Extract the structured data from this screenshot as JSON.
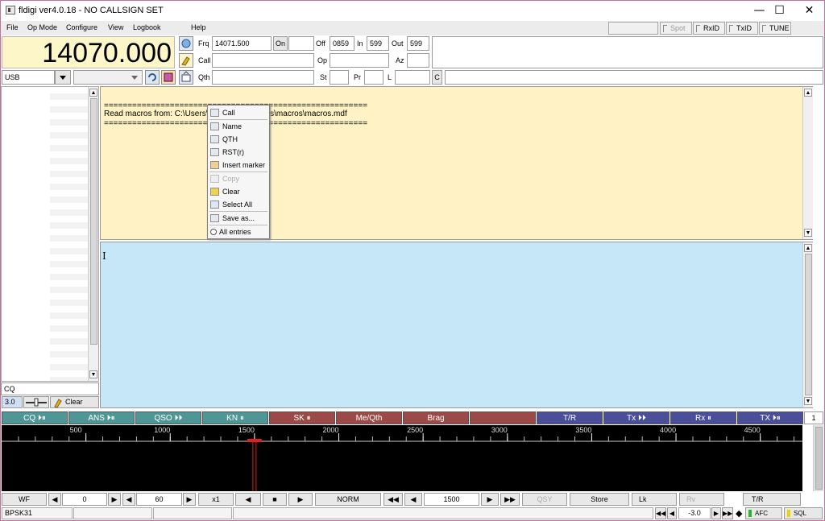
{
  "window": {
    "title": "fldigi ver4.0.18 - NO CALLSIGN SET",
    "minimize": "—",
    "maximize": "☐",
    "close": "✕"
  },
  "menu": {
    "file": "File",
    "op_mode": "Op Mode",
    "configure": "Configure",
    "view": "View",
    "logbook": "Logbook",
    "help": "Help"
  },
  "toolbar": {
    "spot": "Spot",
    "rxid": "RxID",
    "txid": "TxID",
    "tune": "TUNE"
  },
  "freq_display": "14070.000",
  "log": {
    "frq_label": "Frq",
    "frq_value": "14071.500",
    "on_label": "On",
    "on_value": "",
    "off_label": "Off",
    "off_value": "0859",
    "in_label": "In",
    "in_value": "599",
    "out_label": "Out",
    "out_value": "599",
    "call_label": "Call",
    "call_value": "",
    "op_label": "Op",
    "op_value": "",
    "az_label": "Az",
    "az_value": "",
    "qth_label": "Qth",
    "qth_value": "",
    "st_label": "St",
    "st_value": "",
    "pr_label": "Pr",
    "pr_value": "",
    "l_label": "L",
    "l_value": "",
    "c_label": "C",
    "notes_value": ""
  },
  "mode": {
    "value": "USB",
    "bandwidth": ""
  },
  "rx_text": {
    "line1": "========================================================",
    "line2": "Read macros from: C:\\Users\\                        iles\\macros\\macros.mdf",
    "line3": "========================================================"
  },
  "context_menu": {
    "items": [
      "Call",
      "Name",
      "QTH",
      "RST(r)",
      "Insert marker",
      "Copy",
      "Clear",
      "Select All",
      "Save as...",
      "All entries"
    ]
  },
  "left_panel": {
    "cq_label": "CQ",
    "zoom_value": "3.0",
    "clear_label": "Clear"
  },
  "macros": [
    {
      "label": "CQ ⏵⏸",
      "color": "#4f9796"
    },
    {
      "label": "ANS ⏵⏸",
      "color": "#4f9796"
    },
    {
      "label": "QSO ⏵⏵",
      "color": "#4f9796"
    },
    {
      "label": "KN ⏸",
      "color": "#4f9796"
    },
    {
      "label": "SK ⏸",
      "color": "#9c4a48"
    },
    {
      "label": "Me/Qth",
      "color": "#9c4a48"
    },
    {
      "label": "Brag",
      "color": "#9c4a48"
    },
    {
      "label": "",
      "color": "#9c4a48"
    },
    {
      "label": "T/R",
      "color": "#4b4f9a"
    },
    {
      "label": "Tx ⏵⏵",
      "color": "#4b4f9a"
    },
    {
      "label": "Rx ⏸",
      "color": "#4b4f9a"
    },
    {
      "label": "TX ⏵⏸",
      "color": "#4b4f9a"
    }
  ],
  "macro_set": "1",
  "scale": {
    "ticks": [
      "500",
      "1000",
      "1500",
      "2000",
      "2500",
      "3000",
      "3500",
      "4000",
      "4500"
    ],
    "max": 4750
  },
  "bottom": {
    "wf": "WF",
    "offset": "0",
    "range": "60",
    "zoom": "x1",
    "norm": "NORM",
    "carrier": "1500",
    "qsy": "QSY",
    "store": "Store",
    "lk": "Lk",
    "rv": "Rv",
    "tr": "T/R"
  },
  "status": {
    "mode": "BPSK31",
    "s2": "",
    "s3": "",
    "s4": "",
    "snr": "-3.0",
    "afc": "AFC",
    "sql": "SQL"
  }
}
